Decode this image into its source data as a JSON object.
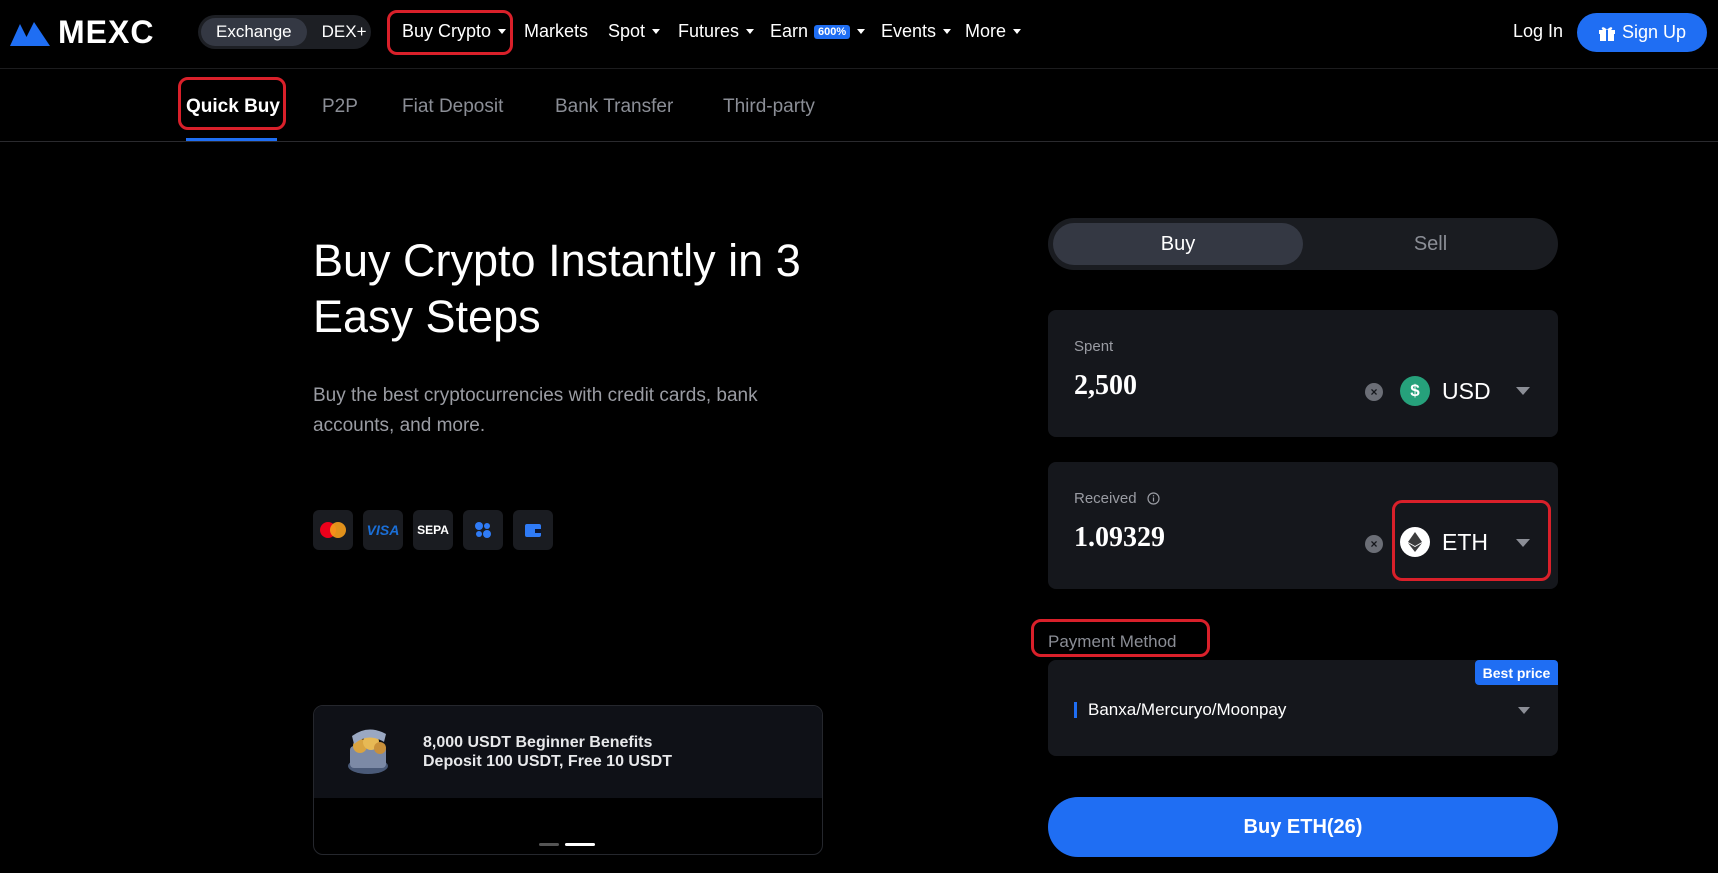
{
  "brand": {
    "name": "MEXC"
  },
  "topnav": {
    "segment": [
      "Exchange",
      "DEX+"
    ],
    "buy_crypto": "Buy Crypto",
    "markets": "Markets",
    "spot": "Spot",
    "futures": "Futures",
    "earn": "Earn",
    "earn_badge": "600%",
    "events": "Events",
    "more": "More",
    "login": "Log In",
    "signup": "Sign Up"
  },
  "subtabs": [
    "Quick Buy",
    "P2P",
    "Fiat Deposit",
    "Bank Transfer",
    "Third-party"
  ],
  "hero": {
    "title": "Buy Crypto Instantly in 3 Easy Steps",
    "subtitle": "Buy the best cryptocurrencies with credit cards, bank accounts, and more.",
    "payment_logos": [
      "mastercard-icon",
      "VISA",
      "SEPA",
      "apple-pay-icon",
      "wallet-icon"
    ]
  },
  "promo": {
    "line1": "8,000 USDT Beginner Benefits",
    "line2": "Deposit 100 USDT, Free 10 USDT"
  },
  "trade": {
    "buy": "Buy",
    "sell": "Sell",
    "spent_label": "Spent",
    "spent_value": "2,500",
    "spent_currency": "USD",
    "received_label": "Received",
    "received_value": "1.09329",
    "received_currency": "ETH",
    "payment_label": "Payment Method",
    "best_price": "Best price",
    "payment_provider": "Banxa/Mercuryo/Moonpay",
    "cta": "Buy ETH(26)"
  },
  "colors": {
    "accent": "#1f6ef3",
    "highlight": "#d9202a",
    "usd": "#26a17b"
  }
}
